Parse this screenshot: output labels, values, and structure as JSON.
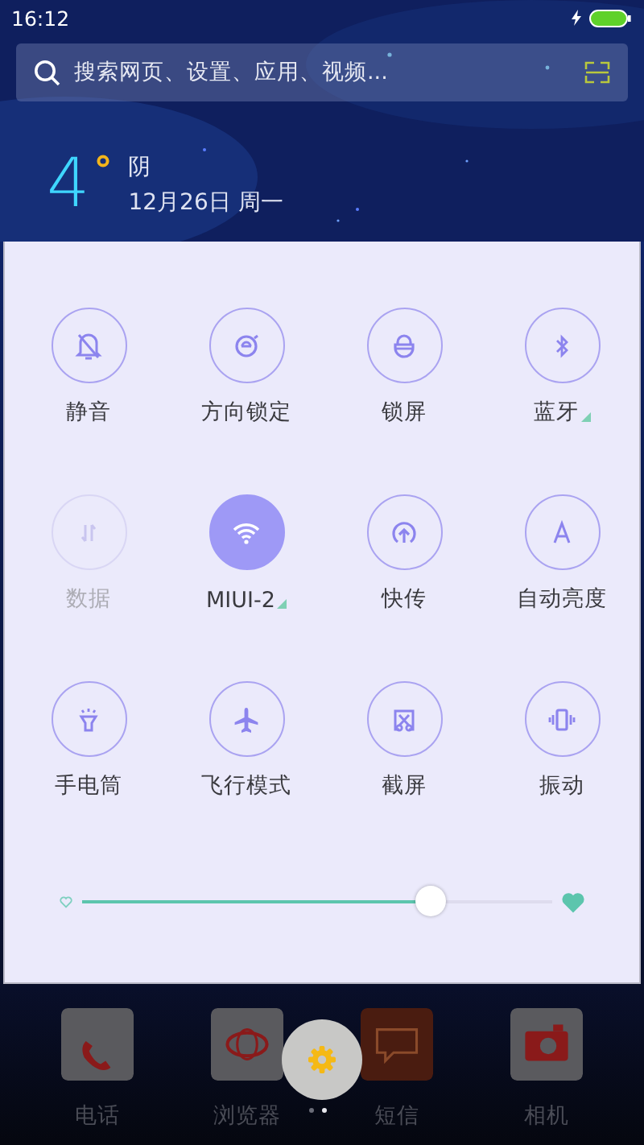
{
  "status_bar": {
    "time": "16:12"
  },
  "search": {
    "placeholder": "搜索网页、设置、应用、视频..."
  },
  "weather": {
    "temperature": "4",
    "condition": "阴",
    "date": "12月26日 周一"
  },
  "toggles": [
    {
      "label": "静音",
      "on": false,
      "disabled": false,
      "has_menu": false
    },
    {
      "label": "方向锁定",
      "on": false,
      "disabled": false,
      "has_menu": false
    },
    {
      "label": "锁屏",
      "on": false,
      "disabled": false,
      "has_menu": false
    },
    {
      "label": "蓝牙",
      "on": false,
      "disabled": false,
      "has_menu": true
    },
    {
      "label": "数据",
      "on": false,
      "disabled": true,
      "has_menu": false
    },
    {
      "label": "MIUI-2",
      "on": true,
      "disabled": false,
      "has_menu": true
    },
    {
      "label": "快传",
      "on": false,
      "disabled": false,
      "has_menu": false
    },
    {
      "label": "自动亮度",
      "on": false,
      "disabled": false,
      "has_menu": false
    },
    {
      "label": "手电筒",
      "on": false,
      "disabled": false,
      "has_menu": false
    },
    {
      "label": "飞行模式",
      "on": false,
      "disabled": false,
      "has_menu": false
    },
    {
      "label": "截屏",
      "on": false,
      "disabled": false,
      "has_menu": false
    },
    {
      "label": "振动",
      "on": false,
      "disabled": false,
      "has_menu": false
    }
  ],
  "brightness": {
    "level": 0.74
  },
  "dock": [
    {
      "label": "电话"
    },
    {
      "label": "浏览器"
    },
    {
      "label": "短信"
    },
    {
      "label": "相机"
    }
  ],
  "page_dots": [
    {
      "selected": false
    },
    {
      "selected": true
    }
  ]
}
